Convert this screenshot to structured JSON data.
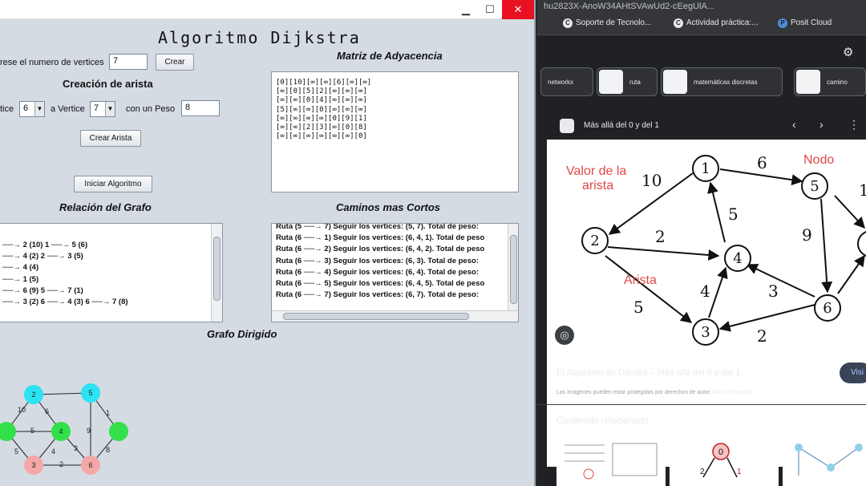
{
  "java": {
    "title": "Algoritmo Dijkstra",
    "num_vertices_label": "rese el numero de vertices",
    "num_vertices_value": "7",
    "crear_button": "Crear",
    "creacion_arista_title": "Creación de arista",
    "de_vertice_label": "tice",
    "de_vertice_value": "6",
    "a_vertice_label": "a Vertice",
    "a_vertice_value": "7",
    "peso_label": "con un Peso",
    "peso_value": "8",
    "crear_arista_button": "Crear Arista",
    "iniciar_button": "Iniciar Algoritmo",
    "relacion_title": "Relación del Grafo",
    "relacion_rows": [
      "──→ 2 (10)  1 ──→ 5 (6)",
      "──→ 4 (2)  2 ──→ 3 (5)",
      "──→ 4 (4)",
      "──→ 1 (5)",
      "──→ 6 (9)  5 ──→ 7 (1)",
      "──→ 3 (2)  6 ──→ 4 (3)  6 ──→ 7 (8)"
    ],
    "matriz_title": "Matriz de Adyacencia",
    "matriz_rows": [
      "[0][10][∞][∞][6][∞][∞]",
      "[∞][0][5][2][∞][∞][∞]",
      "[∞][∞][0][4][∞][∞][∞]",
      "[5][∞][∞][0][∞][∞][∞]",
      "[∞][∞][∞][∞][0][9][1]",
      "[∞][∞][2][3][∞][0][8]",
      "[∞][∞][∞][∞][∞][∞][0]"
    ],
    "caminos_title": "Caminos mas Cortos",
    "caminos_rows": [
      "Ruta (5 ──→ 7) Seguir los vertices: (5, 7). Total de peso:",
      "Ruta (6 ──→ 1) Seguir los vertices: (6, 4, 1). Total de peso",
      "Ruta (6 ──→ 2) Seguir los vertices: (6, 4, 2). Total de peso",
      "Ruta (6 ──→ 3) Seguir los vertices: (6, 3).  Total de peso:",
      "Ruta (6 ──→ 4) Seguir los vertices: (6, 4).  Total de peso:",
      "Ruta (6 ──→ 5) Seguir los vertices: (6, 4, 5). Total de peso",
      "Ruta (6 ──→ 7) Seguir los vertices: (6, 7).  Total de peso:"
    ],
    "grafo_title": "Grafo Dirigido",
    "mini_nodes": [
      "2",
      "5",
      "4",
      "3",
      "6"
    ],
    "mini_edge_labels": [
      "10",
      "5",
      "6",
      "9",
      "1",
      "4",
      "3",
      "5",
      "2",
      "8"
    ],
    "window_buttons": [
      "▁",
      "☐",
      "✕"
    ]
  },
  "chrome": {
    "url": "hu2823X-AnoW34AHtSVAwUd2-cEegUlA...",
    "bookmarks": [
      "Soporte de Tecnolo...",
      "Actividad práctica:...",
      "Posit Cloud"
    ],
    "chips": [
      "networkx",
      "ruta",
      "matemáticas discretas",
      "camino"
    ],
    "source": "Más allá del 0 y del 1",
    "result_title": "El Algoritmo de Dijkstra – Más allá del 0 y del 1",
    "visit": "Visi",
    "disclaimer": "Las imágenes pueden estar protegidas por derechos de autor.",
    "more_info": "Más información",
    "related": "Contenido relacionado",
    "diagram": {
      "label_valor": "Valor de la arista",
      "label_nodo": "Nodo",
      "label_arista": "Arista",
      "nodes": [
        "1",
        "2",
        "3",
        "4",
        "5",
        "6"
      ],
      "weights": [
        "10",
        "6",
        "5",
        "2",
        "9",
        "4",
        "3",
        "5",
        "2"
      ],
      "edge_right": "1"
    },
    "related_node": "0",
    "related_weights": [
      "2",
      "1"
    ]
  }
}
